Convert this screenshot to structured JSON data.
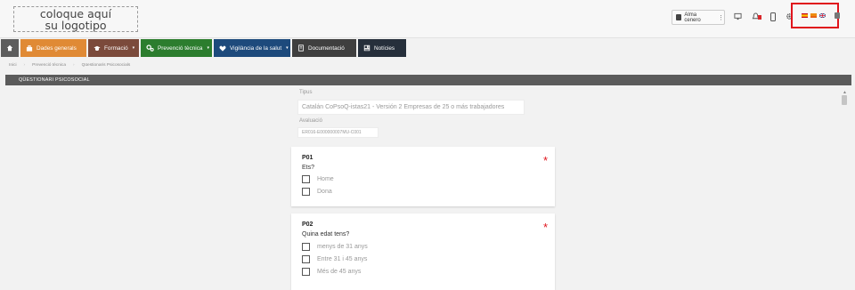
{
  "header": {
    "logo_line1": "coloque aquí",
    "logo_line2": "su logotipo",
    "user_name": "Alma cenero",
    "user_menu_glyph": "⋮"
  },
  "colors": {
    "nav_home": "#5d5d5d",
    "nav_dades": "#e08a35",
    "nav_formacio": "#7b4a3b",
    "nav_prevencio": "#2c7d2e",
    "nav_vigilancia": "#1d4a7c",
    "nav_documentacio": "#3f3f3f",
    "nav_noticies": "#262f3b",
    "required": "#e0141c"
  },
  "nav": {
    "items": [
      {
        "label": "",
        "icon": "home-icon"
      },
      {
        "label": "Dades generals",
        "icon": "briefcase-icon"
      },
      {
        "label": "Formació",
        "icon": "graduation-cap-icon",
        "dropdown": true
      },
      {
        "label": "Prevenció tècnica",
        "icon": "cogs-icon",
        "dropdown": true
      },
      {
        "label": "Vigilància de la salut",
        "icon": "heartbeat-icon",
        "dropdown": true
      },
      {
        "label": "Documentació",
        "icon": "book-icon"
      },
      {
        "label": "Notícies",
        "icon": "newspaper-icon"
      }
    ],
    "caret": "▾"
  },
  "breadcrumb": [
    "Inici",
    "Prevenció tècnica",
    "Qüestionaris Psicosocials"
  ],
  "page_title": "QÜESTIONARI PSICOSOCIAL",
  "form": {
    "tipus_label": "Tipus",
    "tipus_value": "Catalán CoPsoQ-istas21 - Versión 2 Empresas de 25 o más trabajadores",
    "avaluacio_label": "Avaluació",
    "avaluacio_value": "ER016-E000000007MU-C001"
  },
  "required_mark": "*",
  "questions": [
    {
      "id": "P01",
      "text": "Ets?",
      "options": [
        "Home",
        "Dona"
      ]
    },
    {
      "id": "P02",
      "text": "Quina edat tens?",
      "options": [
        "menys de 31 anys",
        "Entre 31 i 45 anys",
        "Més de 45 anys"
      ]
    }
  ],
  "flags": [
    "spain-flag-icon",
    "catalonia-flag-icon",
    "uk-flag-icon"
  ]
}
